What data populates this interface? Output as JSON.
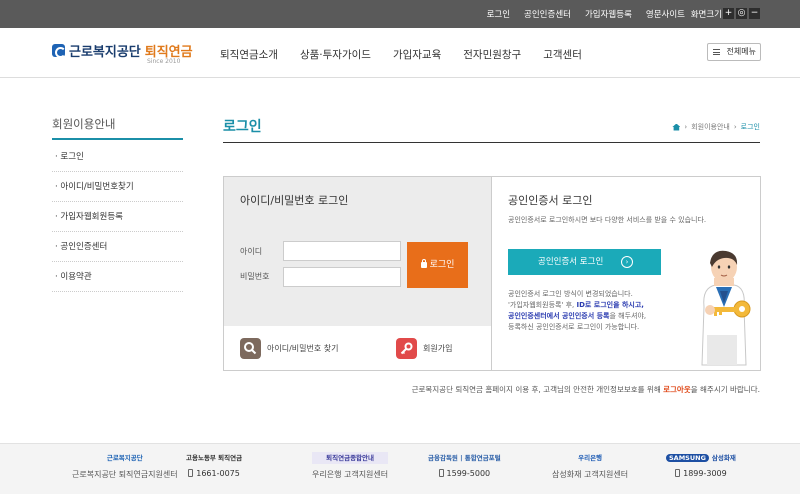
{
  "topbar": {
    "links": [
      "로그인",
      "공인인증센터",
      "가입자웹등록",
      "영문사이트"
    ],
    "zoom_label": "화면크기",
    "zoom_buttons": [
      "+",
      "◎",
      "−"
    ]
  },
  "header": {
    "logo_main": "근로복지공단",
    "logo_sub": "퇴직연금",
    "logo_since": "Since 2010",
    "nav": [
      "퇴직연금소개",
      "상품·투자가이드",
      "가입자교육",
      "전자민원창구",
      "고객센터"
    ],
    "all_menu": "전체메뉴"
  },
  "sidebar": {
    "title": "회원이용안내",
    "items": [
      "· 로그인",
      "· 아이디/비밀번호찾기",
      "· 가입자웹회원등록",
      "· 공인인증센터",
      "· 이용약관"
    ]
  },
  "main": {
    "title": "로그인",
    "breadcrumb": {
      "parent": "회원이용안내",
      "current": "로그인"
    }
  },
  "id_login": {
    "title": "아이디/비밀번호 로그인",
    "id_label": "아이디",
    "pw_label": "비밀번호",
    "id_value": "",
    "pw_value": "",
    "button": "로그인",
    "find_link": "아이디/비밀번호 찾기",
    "join_link": "회원가입"
  },
  "cert_login": {
    "title": "공인인증서 로그인",
    "desc": "공인인증서로 로그인하시면 보다 다양한 서비스를 받을 수 있습니다.",
    "button": "공인인증서 로그인",
    "note_line1": "공인인증서 로그인 방식이 변경되었습니다.",
    "note_line2_a": "'가입자웹회원등록' 후, ",
    "note_line2_em": "ID로 로그인을 하시고,",
    "note_line3_em": "공인인증센터에서 공인인증서 등록",
    "note_line3_b": "을 해두셔야,",
    "note_line4": "등록하신 공인인증서로 로그인이 가능합니다."
  },
  "notice": {
    "text_a": "근로복지공단 퇴직연금 홈페이지 이용 후, 고객님의 안전한 개인정보보호를 위해 ",
    "text_em": "로그아웃",
    "text_b": "을 해주시기 바랍니다."
  },
  "footer": {
    "logos": [
      "근로복지공단",
      "고용노동부 퇴직연금",
      "퇴직연금종합안내",
      "금융감독원 | 통합연금포털",
      "우리은행",
      "삼성화재"
    ],
    "samsung": "SAMSUNG",
    "insurance": "삼성화재",
    "centers": [
      {
        "name": "근로복지공단 퇴직연금지원센터",
        "phone": "1661-0075"
      },
      {
        "name": "우리은행 고객지원센터",
        "phone": "1599-5000"
      },
      {
        "name": "삼성화재 고객지원센터",
        "phone": "1899-3009"
      }
    ]
  },
  "colors": {
    "accent": "#1b8fa8",
    "login_button": "#e86e1a",
    "cert_button": "#1baab9",
    "emphasis_blue": "#2b3cb0",
    "logout_red": "#e04a1a"
  }
}
